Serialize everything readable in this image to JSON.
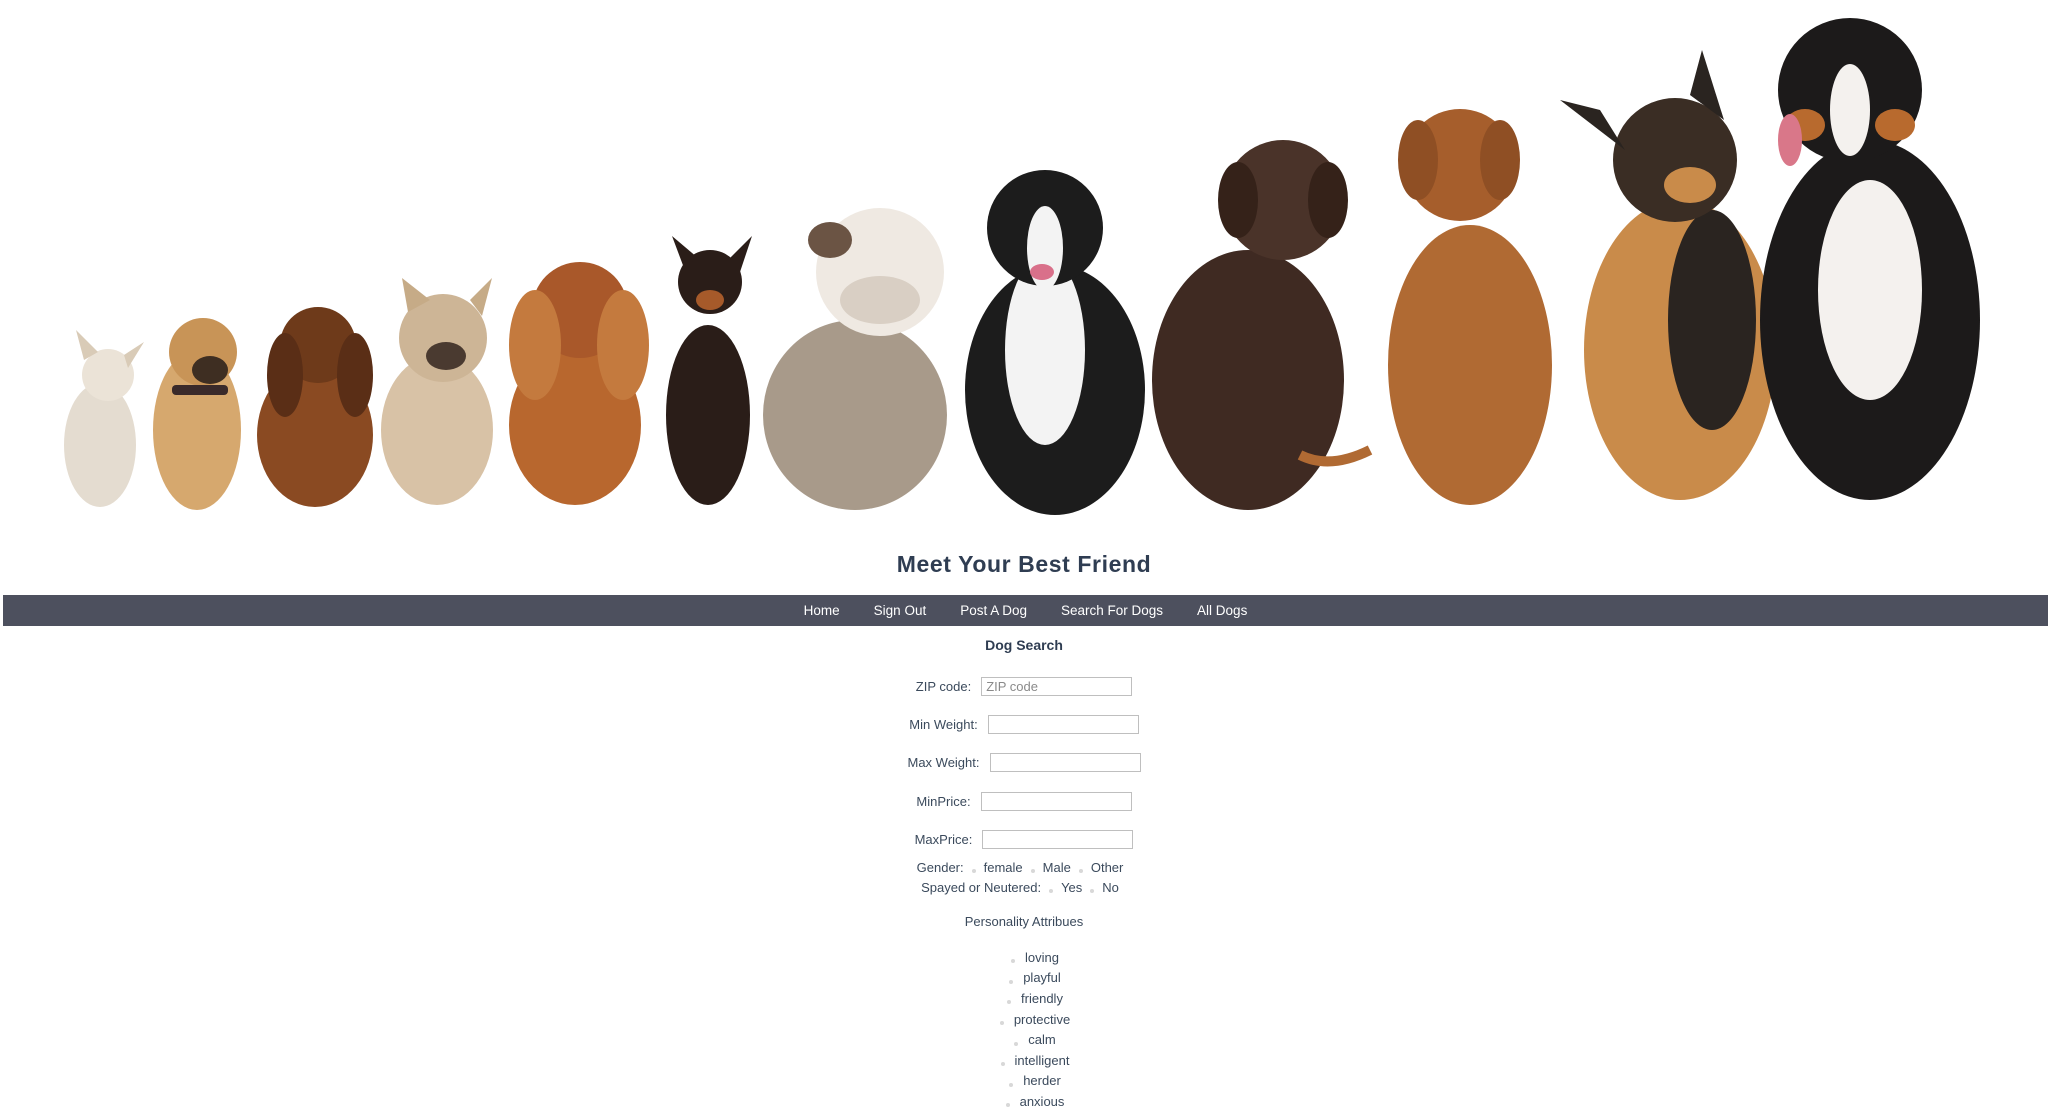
{
  "site": {
    "title": "Meet Your Best Friend"
  },
  "nav": {
    "items": [
      {
        "label": "Home"
      },
      {
        "label": "Sign Out"
      },
      {
        "label": "Post A Dog"
      },
      {
        "label": "Search For Dogs"
      },
      {
        "label": "All Dogs"
      }
    ]
  },
  "form": {
    "title": "Dog Search",
    "fields": [
      {
        "label": "ZIP code:",
        "placeholder": "ZIP code",
        "value": ""
      },
      {
        "label": "Min Weight:",
        "placeholder": "",
        "value": ""
      },
      {
        "label": "Max Weight:",
        "placeholder": "",
        "value": ""
      },
      {
        "label": "MinPrice:",
        "placeholder": "",
        "value": ""
      },
      {
        "label": "MaxPrice:",
        "placeholder": "",
        "value": ""
      }
    ],
    "gender": {
      "label": "Gender:",
      "options": [
        "female",
        "Male",
        "Other"
      ]
    },
    "spayed": {
      "label": "Spayed or Neutered:",
      "options": [
        "Yes",
        "No"
      ]
    },
    "personality": {
      "title": "Personality Attribues",
      "items": [
        "loving",
        "playful",
        "friendly",
        "protective",
        "calm",
        "intelligent",
        "herder",
        "anxious"
      ]
    }
  },
  "colors": {
    "nav_background": "#4d505e",
    "title_text": "#2f3d52",
    "body_text": "#3b4a5c"
  }
}
